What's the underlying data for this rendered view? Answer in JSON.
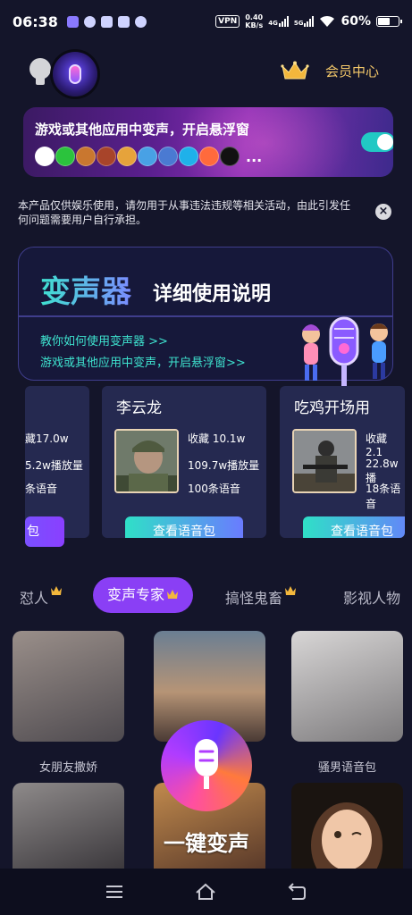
{
  "status_bar": {
    "time": "06:38",
    "vpn": "VPN",
    "speed_value": "0.40",
    "speed_unit": "KB/s",
    "network_4g": "4G",
    "network_5g": "5G",
    "battery_pct": "60%",
    "icons": [
      "notification-icon",
      "app-icon",
      "mail-icon",
      "taobao-icon",
      "telegram-icon",
      "wifi-icon",
      "battery-icon"
    ]
  },
  "header": {
    "profile_icon": "profile-icon",
    "logo_icon": "microphone-logo-icon",
    "vip_icon": "crown-icon",
    "vip_label": "会员中心"
  },
  "float_banner": {
    "title": "游戏或其他应用中变声，开启悬浮窗",
    "toggle_on": true,
    "ellipsis": "...",
    "app_icons": [
      {
        "name": "qq-icon",
        "color": "#ffffff"
      },
      {
        "name": "wechat-icon",
        "color": "#2bc33d"
      },
      {
        "name": "game-icon-1",
        "color": "#c9772f"
      },
      {
        "name": "game-icon-2",
        "color": "#a8442a"
      },
      {
        "name": "game-icon-3",
        "color": "#e6a33b"
      },
      {
        "name": "game-icon-4",
        "color": "#48a1e5"
      },
      {
        "name": "game-icon-5",
        "color": "#4a7ad2"
      },
      {
        "name": "bilibili-icon",
        "color": "#1fb1ea"
      },
      {
        "name": "game-icon-6",
        "color": "#ff6a3c"
      },
      {
        "name": "tiktok-icon",
        "color": "#111111"
      }
    ]
  },
  "disclaimer": {
    "text": "本产品仅供娱乐使用，请勿用于从事违法违规等相关活动，由此引发任何问题需要用户自行承担。"
  },
  "guide": {
    "title_main": "变声器",
    "title_sub": "详细使用说明",
    "link_1": "教你如何使用变声器 >>",
    "link_2": "游戏或其他应用中变声，开启悬浮窗>>"
  },
  "packs": {
    "left_partial": {
      "stat_1": "藏17.0w",
      "stat_2": "5.2w播放量",
      "stat_3": "条语音",
      "button": "包"
    },
    "center": {
      "name": "李云龙",
      "stat_1": "收藏 10.1w",
      "stat_2": "109.7w播放量",
      "stat_3": "100条语音",
      "button": "查看语音包"
    },
    "right": {
      "name": "吃鸡开场用",
      "stat_1": "收藏 2.1",
      "stat_2": "22.8w播",
      "stat_3": "18条语音",
      "button": "查看语音包"
    }
  },
  "tabs": [
    {
      "label": "怼人",
      "active": false
    },
    {
      "label": "变声专家",
      "active": true
    },
    {
      "label": "搞怪鬼畜",
      "active": false
    },
    {
      "label": "影视人物",
      "active": false
    }
  ],
  "grid": {
    "item_1_label": "女朋友撒娇",
    "item_2_label": "",
    "item_3_label": "骚男语音包"
  },
  "record_button": {
    "label": "一键变声"
  },
  "nav": {
    "menu": "menu-icon",
    "home": "home-icon",
    "back": "back-icon"
  },
  "colors": {
    "background": "#14152a",
    "accent_purple": "#8a3ff5",
    "accent_teal": "#2fe0c7",
    "gold": "#f5c96a"
  }
}
